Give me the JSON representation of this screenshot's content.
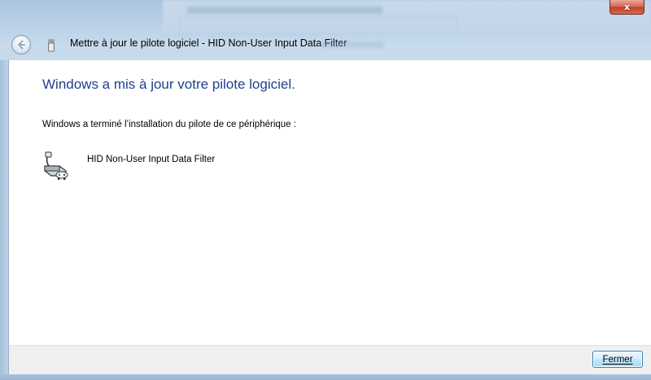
{
  "window": {
    "title": "Mettre à jour le pilote logiciel - HID Non-User Input Data Filter",
    "close_glyph": "x",
    "back_icon": "back-arrow-icon",
    "device_small_icon": "usb-device-icon"
  },
  "content": {
    "heading": "Windows a mis à jour votre pilote logiciel.",
    "message": "Windows a terminé l’installation du pilote de ce périphérique :",
    "device_name": "HID Non-User Input Data Filter",
    "device_icon": "hid-device-icon"
  },
  "footer": {
    "close_label": "Fermer"
  },
  "colors": {
    "heading": "#1f3f8f",
    "accent_border": "#3c7fb1",
    "close_button": "#c2412a"
  }
}
